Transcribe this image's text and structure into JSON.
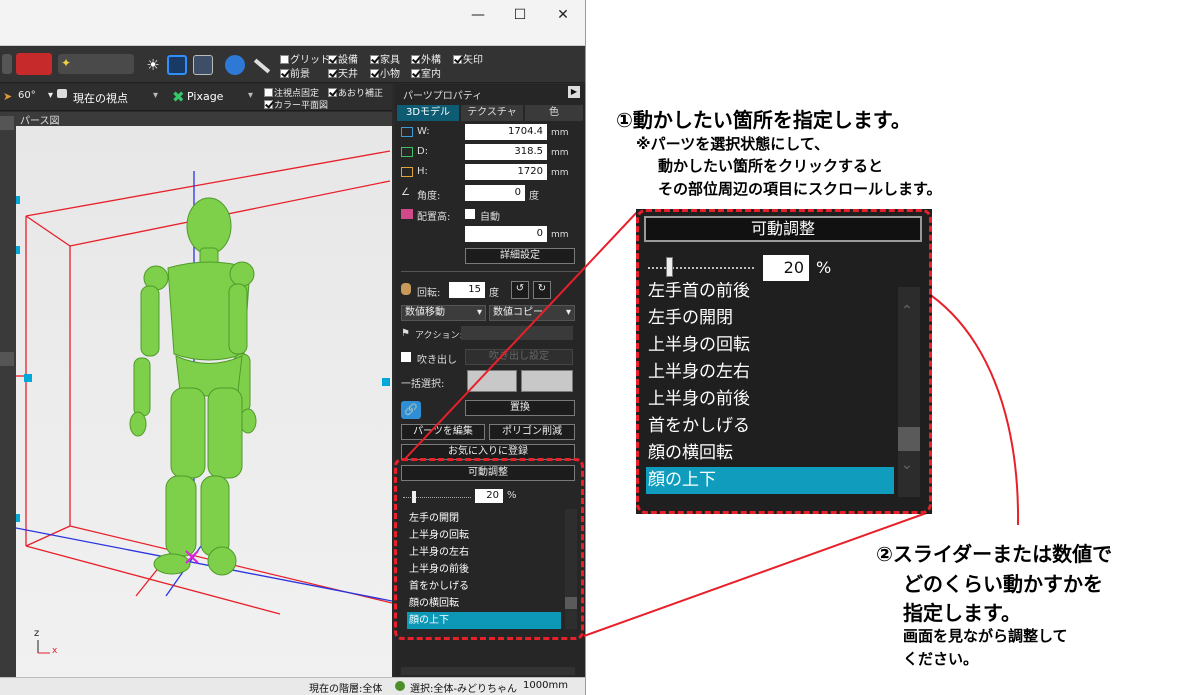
{
  "toolbar": {
    "pixage_label": "Pixage",
    "view_label": "現在の視点",
    "angle_label": "60°",
    "checks": [
      {
        "label": "グリッド",
        "checked": false
      },
      {
        "label": "設備",
        "checked": true
      },
      {
        "label": "家具",
        "checked": true
      },
      {
        "label": "外構",
        "checked": true
      },
      {
        "label": "矢印",
        "checked": true
      },
      {
        "label": "前景",
        "checked": true
      },
      {
        "label": "天井",
        "checked": true
      },
      {
        "label": "小物",
        "checked": true
      },
      {
        "label": "室内",
        "checked": true
      }
    ],
    "checks2": [
      {
        "label": "注視点固定",
        "checked": false
      },
      {
        "label": "あおり補正",
        "checked": true
      },
      {
        "label": "カラー平面図",
        "checked": true
      }
    ]
  },
  "viewport": {
    "title": "パース図",
    "axis_z": "z",
    "axis_x": "x"
  },
  "panel": {
    "title": "パーツプロパティ",
    "tabs": [
      "3Dモデル",
      "テクスチャ",
      "色"
    ],
    "width_label": "W:",
    "width_value": "1704.4",
    "depth_label": "D:",
    "depth_value": "318.5",
    "height_label": "H:",
    "height_value": "1720",
    "unit_mm": "mm",
    "angle_label": "角度:",
    "angle_value": "0",
    "angle_unit": "度",
    "placement_label": "配置高:",
    "auto_label": "自動",
    "placement_value": "0",
    "detail_button": "詳細設定",
    "rotation_label": "回転:",
    "rotation_value": "15",
    "rotation_unit": "度",
    "move_dropdown": "数値移動",
    "copy_dropdown": "数値コピー",
    "action_label": "アクション:",
    "balloon_label": "吹き出し",
    "balloon_setting": "吹き出し設定",
    "bulk_label": "一括選択:",
    "replace_button": "置換",
    "edit_parts_button": "パーツを編集",
    "polygon_button": "ポリゴン削減",
    "favorite_button": "お気に入りに登録",
    "motion_button": "可動調整",
    "slider_value": "20",
    "slider_unit": "%",
    "motion_list": [
      "左手の開閉",
      "上半身の回転",
      "上半身の左右",
      "上半身の前後",
      "首をかしげる",
      "顔の横回転",
      "顔の上下"
    ],
    "selected_index": 6
  },
  "status": {
    "layer": "現在の階層:全体",
    "selection": "選択:全体-みどりちゃん",
    "scale": "1000mm"
  },
  "zoom": {
    "motion_button": "可動調整",
    "slider_value": "20",
    "slider_unit": "%",
    "list": [
      "左手首の前後",
      "左手の開閉",
      "上半身の回転",
      "上半身の左右",
      "上半身の前後",
      "首をかしげる",
      "顔の横回転",
      "顔の上下"
    ],
    "selected_index": 7
  },
  "annotations": {
    "step1_title": "①動かしたい箇所を指定します。",
    "step1_note1": "※パーツを選択状態にして、",
    "step1_note2": "動かしたい箇所をクリックすると",
    "step1_note3": "その部位周辺の項目にスクロールします。",
    "step2_line1": "②スライダーまたは数値で",
    "step2_line2": "どのくらい動かすかを",
    "step2_line3": "指定します。",
    "step2_note1": "画面を見ながら調整して",
    "step2_note2": "ください。"
  },
  "colors": {
    "highlight": "#0d98b8",
    "callout_red": "#e8202a",
    "figure_green": "#7ed04a"
  }
}
